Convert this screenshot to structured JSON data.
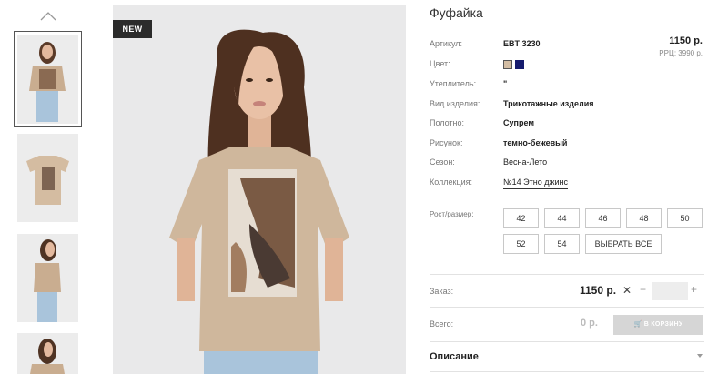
{
  "gallery": {
    "badge": "NEW",
    "icons": {
      "up": "chevron-up-icon"
    }
  },
  "product": {
    "title": "Фуфайка",
    "price": "1150 р.",
    "rrp": "РРЦ: 3990 р.",
    "attributes": [
      {
        "label": "Артикул:",
        "value": "EBT 3230"
      },
      {
        "label": "Цвет:",
        "value": ""
      },
      {
        "label": "Утеплитель:",
        "value": "\""
      },
      {
        "label": "Вид изделия:",
        "value": "Трикотажные изделия"
      },
      {
        "label": "Полотно:",
        "value": "Супрем"
      },
      {
        "label": "Рисунок:",
        "value": "темно-бежевый"
      },
      {
        "label": "Сезон:",
        "value": "Весна-Лето"
      },
      {
        "label": "Коллекция:",
        "value": "№14 Этно джинс"
      }
    ],
    "colors": [
      "#d3bda3",
      "#161b6e"
    ]
  },
  "sizes": {
    "label": "Рост/размер:",
    "options": [
      "42",
      "44",
      "46",
      "48",
      "50",
      "52",
      "54"
    ],
    "select_all": "ВЫБРАТЬ ВСЕ"
  },
  "order": {
    "label": "Заказ:",
    "price": "1150 р.",
    "remove": "✕",
    "minus": "−",
    "plus": "+",
    "quantity": ""
  },
  "total": {
    "label": "Всего:",
    "value": "0 р.",
    "cart_button": "В КОРЗИНУ"
  },
  "description": {
    "title": "Описание"
  }
}
